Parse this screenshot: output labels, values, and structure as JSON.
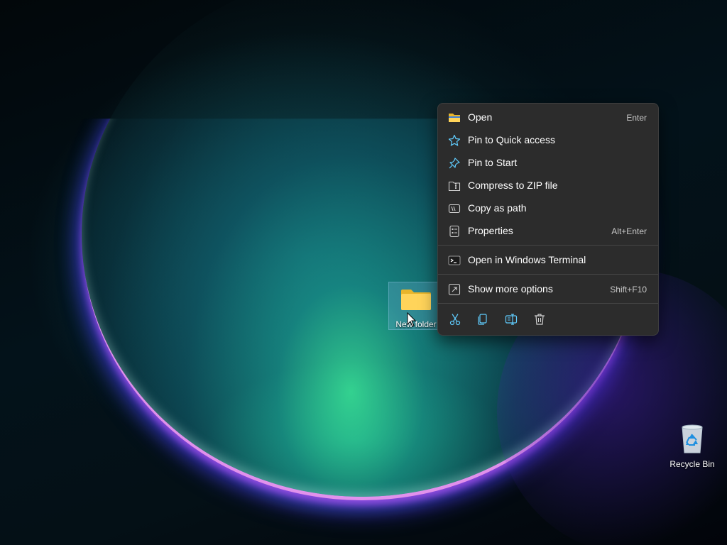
{
  "desktop": {
    "icons": [
      {
        "label": "New folder",
        "icon": "folder-icon",
        "selected": true
      },
      {
        "label": "Recycle Bin",
        "icon": "recycle-bin-icon",
        "selected": false
      }
    ]
  },
  "context_menu": {
    "items": [
      {
        "label": "Open",
        "shortcut": "Enter",
        "icon": "folder-open-icon"
      },
      {
        "label": "Pin to Quick access",
        "shortcut": "",
        "icon": "star-icon"
      },
      {
        "label": "Pin to Start",
        "shortcut": "",
        "icon": "pin-icon"
      },
      {
        "label": "Compress to ZIP file",
        "shortcut": "",
        "icon": "zip-icon"
      },
      {
        "label": "Copy as path",
        "shortcut": "",
        "icon": "copy-path-icon"
      },
      {
        "label": "Properties",
        "shortcut": "Alt+Enter",
        "icon": "properties-icon"
      },
      {
        "label": "Open in Windows Terminal",
        "shortcut": "",
        "icon": "terminal-icon"
      },
      {
        "label": "Show more options",
        "shortcut": "Shift+F10",
        "icon": "more-options-icon"
      }
    ],
    "toolbar": [
      {
        "action": "cut",
        "icon": "scissors-icon"
      },
      {
        "action": "copy",
        "icon": "copy-icon"
      },
      {
        "action": "rename",
        "icon": "rename-icon"
      },
      {
        "action": "delete",
        "icon": "trash-icon"
      }
    ],
    "accent_color": "#60cdff",
    "background_color": "#2c2c2c"
  }
}
